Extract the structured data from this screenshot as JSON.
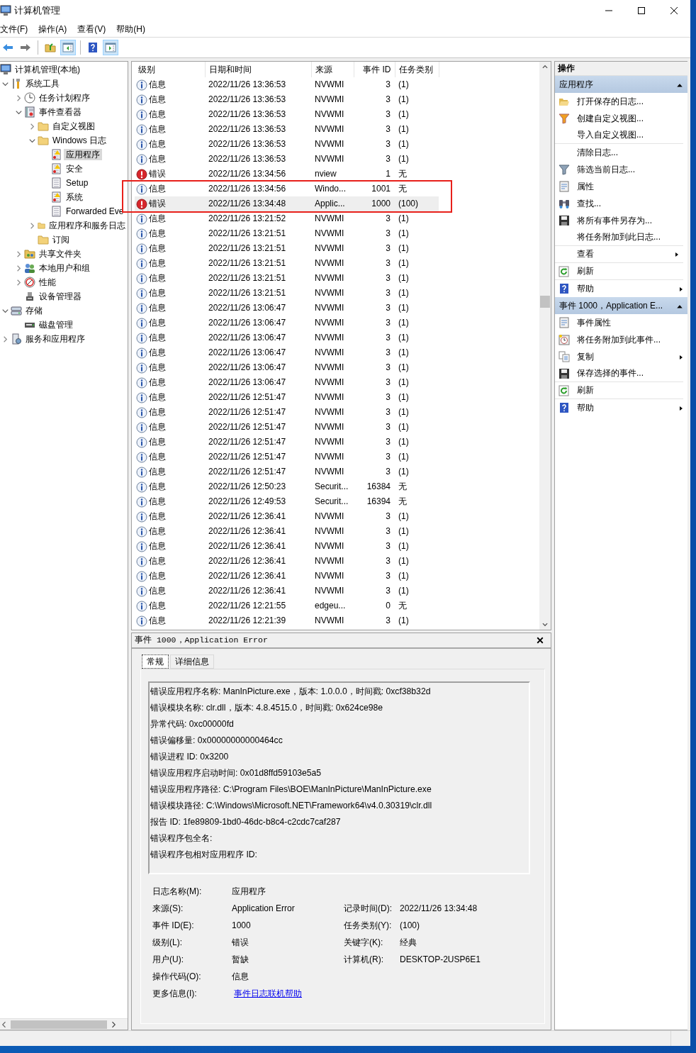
{
  "window": {
    "title": "计算机管理"
  },
  "menu": [
    "文件(F)",
    "操作(A)",
    "查看(V)",
    "帮助(H)"
  ],
  "toolbar": [
    {
      "kind": "back",
      "pressed": false
    },
    {
      "kind": "forward",
      "pressed": false
    },
    {
      "kind": "separator"
    },
    {
      "kind": "up",
      "pressed": false
    },
    {
      "kind": "tree-pane",
      "pressed": true
    },
    {
      "kind": "separator"
    },
    {
      "kind": "help",
      "pressed": false
    },
    {
      "kind": "action-pane",
      "pressed": true
    }
  ],
  "tree": {
    "label": "计算机管理(本地)",
    "kind": "computer",
    "selected": false,
    "children": [
      {
        "label": "系统工具",
        "kind": "tools",
        "expanded": true,
        "selected": false,
        "children": [
          {
            "label": "任务计划程序",
            "kind": "clock",
            "expanded": false,
            "selected": false
          },
          {
            "label": "事件查看器",
            "kind": "eventlog",
            "expanded": true,
            "selected": false,
            "children": [
              {
                "label": "自定义视图",
                "kind": "folder",
                "expanded": false,
                "selected": false
              },
              {
                "label": "Windows 日志",
                "kind": "folder",
                "expanded": true,
                "selected": false,
                "children": [
                  {
                    "label": "应用程序",
                    "kind": "log-alert",
                    "selected": true
                  },
                  {
                    "label": "安全",
                    "kind": "log-alert",
                    "selected": false
                  },
                  {
                    "label": "Setup",
                    "kind": "log",
                    "selected": false
                  },
                  {
                    "label": "系统",
                    "kind": "log-alert",
                    "selected": false
                  },
                  {
                    "label": "Forwarded Eve",
                    "kind": "log",
                    "selected": false
                  }
                ]
              },
              {
                "label": "应用程序和服务日志",
                "kind": "folder",
                "expanded": false,
                "selected": false
              },
              {
                "label": "订阅",
                "kind": "folder",
                "selected": false
              }
            ]
          },
          {
            "label": "共享文件夹",
            "kind": "share",
            "expanded": false,
            "selected": false
          },
          {
            "label": "本地用户和组",
            "kind": "users",
            "expanded": false,
            "selected": false
          },
          {
            "label": "性能",
            "kind": "gauge",
            "expanded": false,
            "selected": false
          },
          {
            "label": "设备管理器",
            "kind": "device",
            "selected": false
          }
        ]
      },
      {
        "label": "存储",
        "kind": "storage",
        "expanded": true,
        "selected": false,
        "children": [
          {
            "label": "磁盘管理",
            "kind": "disk",
            "selected": false
          }
        ]
      },
      {
        "label": "服务和应用程序",
        "kind": "services",
        "expanded": false,
        "selected": false
      }
    ]
  },
  "table": {
    "columns": [
      "级别",
      "日期和时间",
      "来源",
      "事件 ID",
      "任务类别"
    ],
    "rows": [
      {
        "kind": "info",
        "level": "信息",
        "time": "2022/11/26 13:36:53",
        "source": "NVWMI",
        "id": "3",
        "task": "(1)",
        "selected": false
      },
      {
        "kind": "info",
        "level": "信息",
        "time": "2022/11/26 13:36:53",
        "source": "NVWMI",
        "id": "3",
        "task": "(1)",
        "selected": false
      },
      {
        "kind": "info",
        "level": "信息",
        "time": "2022/11/26 13:36:53",
        "source": "NVWMI",
        "id": "3",
        "task": "(1)",
        "selected": false
      },
      {
        "kind": "info",
        "level": "信息",
        "time": "2022/11/26 13:36:53",
        "source": "NVWMI",
        "id": "3",
        "task": "(1)",
        "selected": false
      },
      {
        "kind": "info",
        "level": "信息",
        "time": "2022/11/26 13:36:53",
        "source": "NVWMI",
        "id": "3",
        "task": "(1)",
        "selected": false
      },
      {
        "kind": "info",
        "level": "信息",
        "time": "2022/11/26 13:36:53",
        "source": "NVWMI",
        "id": "3",
        "task": "(1)",
        "selected": false
      },
      {
        "kind": "error",
        "level": "错误",
        "time": "2022/11/26 13:34:56",
        "source": "nview",
        "id": "1",
        "task": "无",
        "selected": false
      },
      {
        "kind": "info",
        "level": "信息",
        "time": "2022/11/26 13:34:56",
        "source": "Windo...",
        "id": "1001",
        "task": "无",
        "selected": false
      },
      {
        "kind": "error",
        "level": "错误",
        "time": "2022/11/26 13:34:48",
        "source": "Applic...",
        "id": "1000",
        "task": "(100)",
        "selected": true
      },
      {
        "kind": "info",
        "level": "信息",
        "time": "2022/11/26 13:21:52",
        "source": "NVWMI",
        "id": "3",
        "task": "(1)",
        "selected": false
      },
      {
        "kind": "info",
        "level": "信息",
        "time": "2022/11/26 13:21:51",
        "source": "NVWMI",
        "id": "3",
        "task": "(1)",
        "selected": false
      },
      {
        "kind": "info",
        "level": "信息",
        "time": "2022/11/26 13:21:51",
        "source": "NVWMI",
        "id": "3",
        "task": "(1)",
        "selected": false
      },
      {
        "kind": "info",
        "level": "信息",
        "time": "2022/11/26 13:21:51",
        "source": "NVWMI",
        "id": "3",
        "task": "(1)",
        "selected": false
      },
      {
        "kind": "info",
        "level": "信息",
        "time": "2022/11/26 13:21:51",
        "source": "NVWMI",
        "id": "3",
        "task": "(1)",
        "selected": false
      },
      {
        "kind": "info",
        "level": "信息",
        "time": "2022/11/26 13:21:51",
        "source": "NVWMI",
        "id": "3",
        "task": "(1)",
        "selected": false
      },
      {
        "kind": "info",
        "level": "信息",
        "time": "2022/11/26 13:06:47",
        "source": "NVWMI",
        "id": "3",
        "task": "(1)",
        "selected": false
      },
      {
        "kind": "info",
        "level": "信息",
        "time": "2022/11/26 13:06:47",
        "source": "NVWMI",
        "id": "3",
        "task": "(1)",
        "selected": false
      },
      {
        "kind": "info",
        "level": "信息",
        "time": "2022/11/26 13:06:47",
        "source": "NVWMI",
        "id": "3",
        "task": "(1)",
        "selected": false
      },
      {
        "kind": "info",
        "level": "信息",
        "time": "2022/11/26 13:06:47",
        "source": "NVWMI",
        "id": "3",
        "task": "(1)",
        "selected": false
      },
      {
        "kind": "info",
        "level": "信息",
        "time": "2022/11/26 13:06:47",
        "source": "NVWMI",
        "id": "3",
        "task": "(1)",
        "selected": false
      },
      {
        "kind": "info",
        "level": "信息",
        "time": "2022/11/26 13:06:47",
        "source": "NVWMI",
        "id": "3",
        "task": "(1)",
        "selected": false
      },
      {
        "kind": "info",
        "level": "信息",
        "time": "2022/11/26 12:51:47",
        "source": "NVWMI",
        "id": "3",
        "task": "(1)",
        "selected": false
      },
      {
        "kind": "info",
        "level": "信息",
        "time": "2022/11/26 12:51:47",
        "source": "NVWMI",
        "id": "3",
        "task": "(1)",
        "selected": false
      },
      {
        "kind": "info",
        "level": "信息",
        "time": "2022/11/26 12:51:47",
        "source": "NVWMI",
        "id": "3",
        "task": "(1)",
        "selected": false
      },
      {
        "kind": "info",
        "level": "信息",
        "time": "2022/11/26 12:51:47",
        "source": "NVWMI",
        "id": "3",
        "task": "(1)",
        "selected": false
      },
      {
        "kind": "info",
        "level": "信息",
        "time": "2022/11/26 12:51:47",
        "source": "NVWMI",
        "id": "3",
        "task": "(1)",
        "selected": false
      },
      {
        "kind": "info",
        "level": "信息",
        "time": "2022/11/26 12:51:47",
        "source": "NVWMI",
        "id": "3",
        "task": "(1)",
        "selected": false
      },
      {
        "kind": "info",
        "level": "信息",
        "time": "2022/11/26 12:50:23",
        "source": "Securit...",
        "id": "16384",
        "task": "无",
        "selected": false
      },
      {
        "kind": "info",
        "level": "信息",
        "time": "2022/11/26 12:49:53",
        "source": "Securit...",
        "id": "16394",
        "task": "无",
        "selected": false
      },
      {
        "kind": "info",
        "level": "信息",
        "time": "2022/11/26 12:36:41",
        "source": "NVWMI",
        "id": "3",
        "task": "(1)",
        "selected": false
      },
      {
        "kind": "info",
        "level": "信息",
        "time": "2022/11/26 12:36:41",
        "source": "NVWMI",
        "id": "3",
        "task": "(1)",
        "selected": false
      },
      {
        "kind": "info",
        "level": "信息",
        "time": "2022/11/26 12:36:41",
        "source": "NVWMI",
        "id": "3",
        "task": "(1)",
        "selected": false
      },
      {
        "kind": "info",
        "level": "信息",
        "time": "2022/11/26 12:36:41",
        "source": "NVWMI",
        "id": "3",
        "task": "(1)",
        "selected": false
      },
      {
        "kind": "info",
        "level": "信息",
        "time": "2022/11/26 12:36:41",
        "source": "NVWMI",
        "id": "3",
        "task": "(1)",
        "selected": false
      },
      {
        "kind": "info",
        "level": "信息",
        "time": "2022/11/26 12:36:41",
        "source": "NVWMI",
        "id": "3",
        "task": "(1)",
        "selected": false
      },
      {
        "kind": "info",
        "level": "信息",
        "time": "2022/11/26 12:21:55",
        "source": "edgeu...",
        "id": "0",
        "task": "无",
        "selected": false
      },
      {
        "kind": "info",
        "level": "信息",
        "time": "2022/11/26 12:21:39",
        "source": "NVWMI",
        "id": "3",
        "task": "(1)",
        "selected": false
      }
    ]
  },
  "detail": {
    "title": "事件 1000，Application Error",
    "tabs": [
      {
        "label": "常规",
        "selected": true
      },
      {
        "label": "详细信息",
        "selected": false
      }
    ],
    "description": [
      "错误应用程序名称: ManInPicture.exe，版本: 1.0.0.0，时间戳: 0xcf38b32d",
      "错误模块名称: clr.dll，版本: 4.8.4515.0，时间戳: 0x624ce98e",
      "异常代码: 0xc00000fd",
      "错误偏移量: 0x00000000000464cc",
      "错误进程 ID: 0x3200",
      "错误应用程序启动时间: 0x01d8ffd59103e5a5",
      "错误应用程序路径: C:\\Program Files\\BOE\\ManInPicture\\ManInPicture.exe",
      "错误模块路径: C:\\Windows\\Microsoft.NET\\Framework64\\v4.0.30319\\clr.dll",
      "报告 ID: 1fe89809-1bd0-46dc-b8c4-c2cdc7caf287",
      "错误程序包全名:",
      "错误程序包相对应用程序 ID:"
    ],
    "field_rows": [
      [
        {
          "label": "日志名称(M):",
          "value": "应用程序",
          "kind": "text"
        }
      ],
      [
        {
          "label": "来源(S):",
          "value": "Application Error",
          "kind": "text"
        },
        {
          "label": "记录时间(D):",
          "value": "2022/11/26 13:34:48",
          "kind": "text"
        }
      ],
      [
        {
          "label": "事件 ID(E):",
          "value": "1000",
          "kind": "text"
        },
        {
          "label": "任务类别(Y):",
          "value": "(100)",
          "kind": "text"
        }
      ],
      [
        {
          "label": "级别(L):",
          "value": "错误",
          "kind": "text"
        },
        {
          "label": "关键字(K):",
          "value": "经典",
          "kind": "text"
        }
      ],
      [
        {
          "label": "用户(U):",
          "value": "暂缺",
          "kind": "text"
        },
        {
          "label": "计算机(R):",
          "value": "DESKTOP-2USP6E1",
          "kind": "text"
        }
      ],
      [
        {
          "label": "操作代码(O):",
          "value": "信息",
          "kind": "text"
        }
      ],
      [
        {
          "label": "更多信息(I):",
          "value": "事件日志联机帮助",
          "kind": "link"
        }
      ]
    ]
  },
  "actions": {
    "title": "操作",
    "sections": [
      {
        "title": "应用程序",
        "expanded": true,
        "items": [
          {
            "label": "打开保存的日志...",
            "kind": "folder-open",
            "submenu": false,
            "group_end": false
          },
          {
            "label": "创建自定义视图...",
            "kind": "funnel-color",
            "submenu": false,
            "group_end": false
          },
          {
            "label": "导入自定义视图...",
            "kind": "none",
            "submenu": false,
            "group_end": true
          },
          {
            "label": "清除日志...",
            "kind": "none",
            "submenu": false,
            "group_end": false
          },
          {
            "label": "筛选当前日志...",
            "kind": "funnel",
            "submenu": false,
            "group_end": false
          },
          {
            "label": "属性",
            "kind": "properties",
            "submenu": false,
            "group_end": false
          },
          {
            "label": "查找...",
            "kind": "binoculars",
            "submenu": false,
            "group_end": false
          },
          {
            "label": "将所有事件另存为...",
            "kind": "floppy",
            "submenu": false,
            "group_end": false
          },
          {
            "label": "将任务附加到此日志...",
            "kind": "none",
            "submenu": false,
            "group_end": true
          },
          {
            "label": "查看",
            "kind": "none",
            "submenu": true,
            "group_end": true
          },
          {
            "label": "刷新",
            "kind": "refresh",
            "submenu": false,
            "group_end": true
          },
          {
            "label": "帮助",
            "kind": "help",
            "submenu": true,
            "group_end": false
          }
        ]
      },
      {
        "title": "事件 1000，Application E...",
        "expanded": true,
        "items": [
          {
            "label": "事件属性",
            "kind": "properties",
            "submenu": false,
            "group_end": false
          },
          {
            "label": "将任务附加到此事件...",
            "kind": "task-clock",
            "submenu": false,
            "group_end": false
          },
          {
            "label": "复制",
            "kind": "copy",
            "submenu": true,
            "group_end": false
          },
          {
            "label": "保存选择的事件...",
            "kind": "floppy",
            "submenu": false,
            "group_end": true
          },
          {
            "label": "刷新",
            "kind": "refresh",
            "submenu": false,
            "group_end": true
          },
          {
            "label": "帮助",
            "kind": "help",
            "submenu": true,
            "group_end": false
          }
        ]
      }
    ]
  }
}
